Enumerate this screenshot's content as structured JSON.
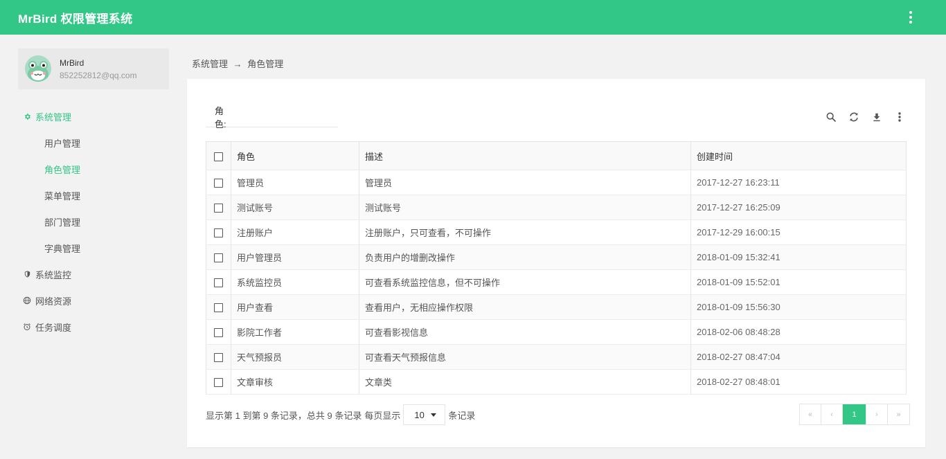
{
  "app": {
    "title": "MrBird 权限管理系统",
    "accent": "#32c787"
  },
  "header": {
    "menu_icon": "more-vertical-icon"
  },
  "profile": {
    "name": "MrBird",
    "email": "852252812@qq.com"
  },
  "sidebar": {
    "items": [
      {
        "label": "系统管理",
        "icon": "gear-icon",
        "active": true,
        "children": [
          {
            "label": "用户管理"
          },
          {
            "label": "角色管理",
            "active": true
          },
          {
            "label": "菜单管理"
          },
          {
            "label": "部门管理"
          },
          {
            "label": "字典管理"
          }
        ]
      },
      {
        "label": "系统监控",
        "icon": "shield-icon"
      },
      {
        "label": "网络资源",
        "icon": "globe-icon"
      },
      {
        "label": "任务调度",
        "icon": "alarm-clock-icon"
      }
    ]
  },
  "breadcrumb": {
    "parent": "系统管理",
    "separator": "→",
    "current": "角色管理"
  },
  "search": {
    "label": "角色:",
    "value": ""
  },
  "toolbar": {
    "icons": [
      "search-icon",
      "refresh-icon",
      "download-icon",
      "more-vertical-icon"
    ]
  },
  "table": {
    "columns": [
      "角色",
      "描述",
      "创建时间"
    ],
    "rows": [
      [
        "管理员",
        "管理员",
        "2017-12-27 16:23:11"
      ],
      [
        "测试账号",
        "测试账号",
        "2017-12-27 16:25:09"
      ],
      [
        "注册账户",
        "注册账户，只可查看，不可操作",
        "2017-12-29 16:00:15"
      ],
      [
        "用户管理员",
        "负责用户的增删改操作",
        "2018-01-09 15:32:41"
      ],
      [
        "系统监控员",
        "可查看系统监控信息，但不可操作",
        "2018-01-09 15:52:01"
      ],
      [
        "用户查看",
        "查看用户，无相应操作权限",
        "2018-01-09 15:56:30"
      ],
      [
        "影院工作者",
        "可查看影视信息",
        "2018-02-06 08:48:28"
      ],
      [
        "天气预报员",
        "可查看天气预报信息",
        "2018-02-27 08:47:04"
      ],
      [
        "文章审核",
        "文章类",
        "2018-02-27 08:48:01"
      ]
    ]
  },
  "pagination": {
    "summary": "显示第 1 到第 9 条记录，总共 9 条记录",
    "per_page_prefix": "每页显示",
    "page_size": "10",
    "per_page_suffix": "条记录",
    "first": "«",
    "prev": "‹",
    "current": "1",
    "next": "›",
    "last": "»"
  }
}
